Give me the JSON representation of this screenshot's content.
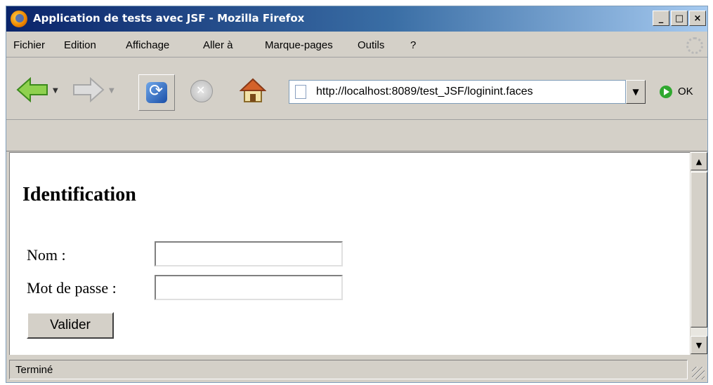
{
  "window": {
    "title": "Application de tests avec JSF - Mozilla Firefox",
    "buttons": {
      "minimize": "_",
      "maximize": "□",
      "close": "×"
    }
  },
  "menu": {
    "items": [
      {
        "label": "Fichier"
      },
      {
        "label": "Edition"
      },
      {
        "label": "Affichage"
      },
      {
        "label": "Aller à"
      },
      {
        "label": "Marque-pages"
      },
      {
        "label": "Outils"
      },
      {
        "label": "?"
      }
    ]
  },
  "toolbar": {
    "url": "http://localhost:8089/test_JSF/loginint.faces",
    "go_label": "OK",
    "icons": [
      "back-icon",
      "forward-icon",
      "reload-icon",
      "stop-icon",
      "home-icon",
      "page-icon",
      "go-icon"
    ]
  },
  "page": {
    "heading": "Identification",
    "name_label": "Nom :",
    "name_value": "",
    "password_label": "Mot de passe :",
    "password_value": "",
    "submit_label": "Valider"
  },
  "status": {
    "text": "Terminé"
  },
  "colors": {
    "titlebar_start": "#0a246a",
    "titlebar_end": "#a6caf0",
    "chrome": "#d4d0c8",
    "content_bg": "#ffffff"
  }
}
